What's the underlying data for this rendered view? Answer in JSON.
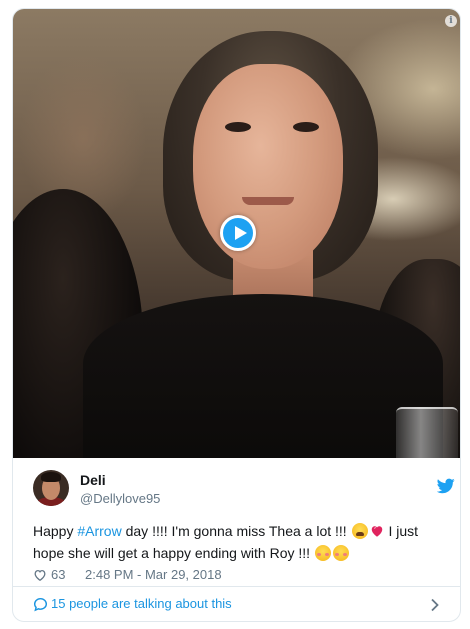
{
  "tweet": {
    "author": {
      "display_name": "Deli",
      "handle": "@Dellylove95"
    },
    "text": {
      "prefix": "Happy ",
      "hashtag": "#Arrow",
      "part_after_hashtag": " day !!!! I'm gonna miss Thea a lot !!! ",
      "part_after_emoji": " I just hope she will get a happy ending with Roy !!! ",
      "emojis": [
        "weary-face-emoji",
        "sparkling-heart-emoji",
        "smiling-blush-emoji",
        "smiling-blush-emoji"
      ]
    },
    "likes": "63",
    "timestamp": "2:48 PM - Mar 29, 2018",
    "talking_about": "15 people are talking about this"
  },
  "media": {
    "type": "video-gif",
    "play_icon": "play-icon",
    "info_icon": "i"
  },
  "colors": {
    "accent": "#1da1f2",
    "link": "#1b95e0",
    "muted": "#657786",
    "border": "#e1e8ed"
  }
}
